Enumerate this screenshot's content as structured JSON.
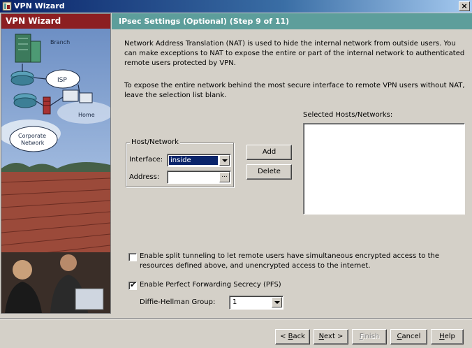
{
  "window": {
    "title": "VPN Wizard",
    "close_glyph": "×"
  },
  "left_panel": {
    "title": "VPN Wizard",
    "diagram_labels": {
      "branch": "Branch",
      "isp": "ISP",
      "home": "Home",
      "corporate": "Corporate",
      "network": "Network"
    }
  },
  "step": {
    "title": "IPsec Settings (Optional)   (Step 9 of 11)"
  },
  "content": {
    "paragraph1": "Network Address Translation (NAT) is used to hide the internal network from outside users. You can make exceptions to NAT to expose the entire or part of the internal network to authenticated remote users protected by VPN.",
    "paragraph2": "To expose the entire network behind the most secure interface to remote VPN users without NAT, leave the selection list blank.",
    "selected_hosts_label": "Selected Hosts/Networks:",
    "host_network": {
      "legend": "Host/Network",
      "interface_label": "Interface:",
      "interface_value": "inside",
      "address_label": "Address:",
      "address_value": "",
      "browse_glyph": "..."
    },
    "buttons": {
      "add": "Add",
      "delete": "Delete"
    },
    "split_tunneling": {
      "checked": false,
      "label": "Enable split tunneling to let remote users have simultaneous encrypted access to the resources defined above, and unencrypted access to the internet."
    },
    "pfs": {
      "checked": true,
      "check_glyph": "✔",
      "label": "Enable Perfect Forwarding Secrecy (PFS)"
    },
    "dh_group": {
      "label": "Diffie-Hellman Group:",
      "value": "1"
    }
  },
  "footer": {
    "back": {
      "mnemonic": "B",
      "rest": "ack",
      "prefix": "< "
    },
    "next": {
      "mnemonic": "N",
      "rest": "ext >"
    },
    "finish": {
      "mnemonic": "F",
      "rest": "inish"
    },
    "cancel": {
      "mnemonic": "C",
      "rest": "ancel"
    },
    "help": {
      "mnemonic": "H",
      "rest": "elp"
    }
  },
  "colors": {
    "left_header": "#8c1f22",
    "right_header": "#5d9e9b",
    "selection": "#0a246a"
  }
}
